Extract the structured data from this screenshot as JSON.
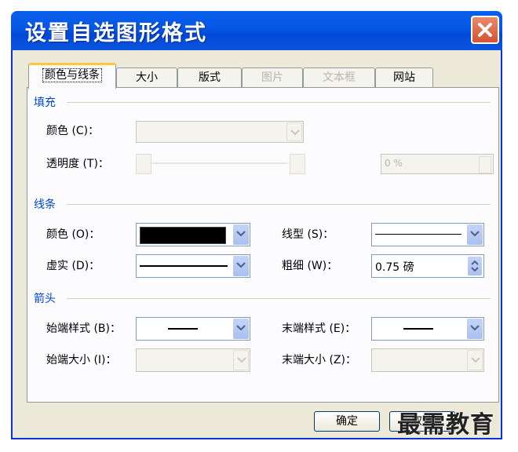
{
  "window": {
    "title": "设置自选图形格式"
  },
  "tabs": [
    {
      "label": "颜色与线条",
      "state": "active"
    },
    {
      "label": "大小",
      "state": "normal"
    },
    {
      "label": "版式",
      "state": "normal"
    },
    {
      "label": "图片",
      "state": "disabled"
    },
    {
      "label": "文本框",
      "state": "disabled"
    },
    {
      "label": "网站",
      "state": "normal"
    }
  ],
  "fill": {
    "section": "填充",
    "color_label": "颜色 (C)：",
    "transparency_label": "透明度 (T)：",
    "transparency_value": "0 %"
  },
  "line": {
    "section": "线条",
    "color_label": "颜色 (O)：",
    "color_value": "#000000",
    "dash_label": "虚实 (D)：",
    "style_label": "线型 (S)：",
    "weight_label": "粗细 (W)：",
    "weight_value": "0.75 磅"
  },
  "arrows": {
    "section": "箭头",
    "begin_style_label": "始端样式 (B)：",
    "begin_size_label": "始端大小 (I)：",
    "end_style_label": "末端样式 (E)：",
    "end_size_label": "末端大小 (Z)："
  },
  "buttons": {
    "ok": "确定",
    "cancel": "取消"
  },
  "watermark": "最需教育"
}
